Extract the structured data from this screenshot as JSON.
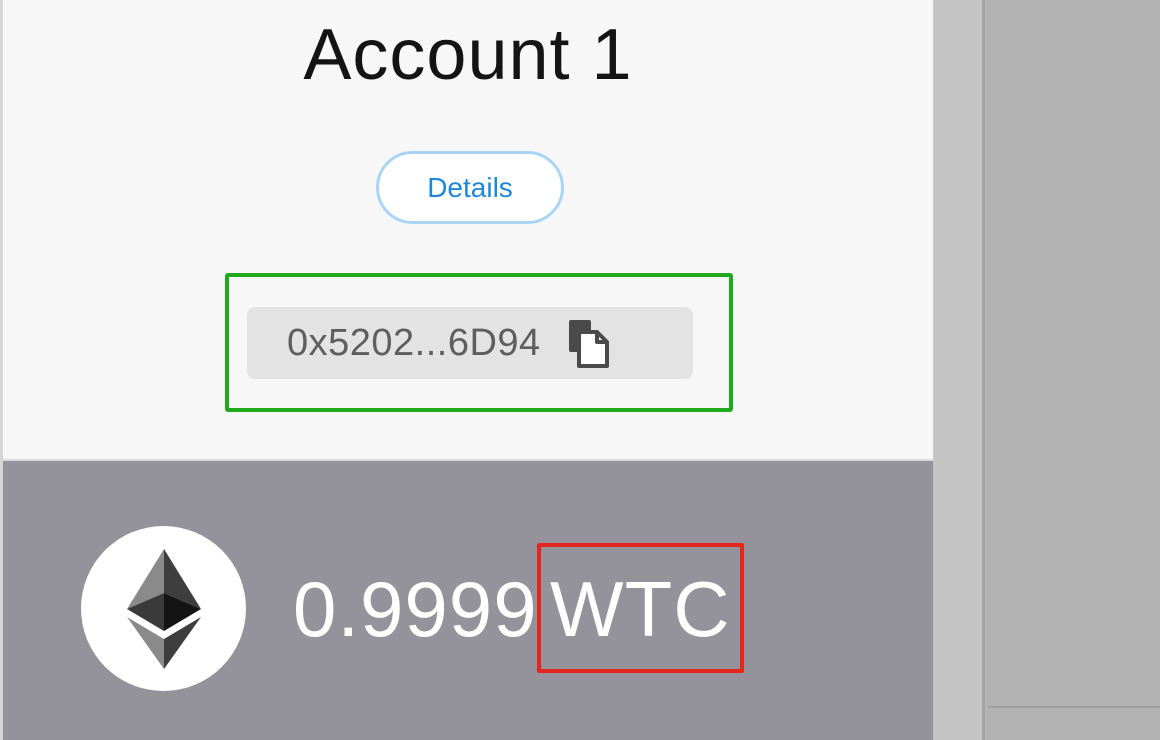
{
  "account": {
    "name": "Account 1",
    "details_label": "Details",
    "address_short": "0x5202...6D94",
    "copy_icon": "copy-icon"
  },
  "balance": {
    "amount": "0.9999",
    "symbol": "WTC",
    "token_icon": "ethereum-icon"
  },
  "colors": {
    "details_accent": "#1e88d8",
    "address_highlight": "#21a91c",
    "symbol_highlight": "#e5261d",
    "balance_band": "#94939c"
  }
}
